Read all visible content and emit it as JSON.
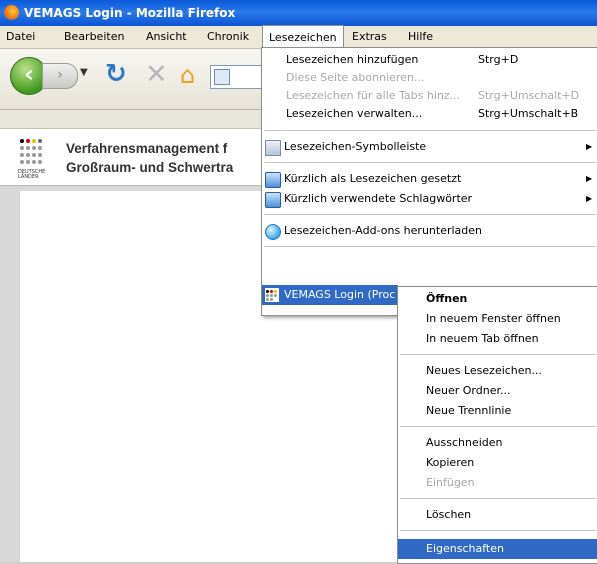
{
  "window": {
    "title": "VEMAGS Login - Mozilla Firefox"
  },
  "menubar": {
    "items": [
      {
        "label": "Datei"
      },
      {
        "label": "Bearbeiten"
      },
      {
        "label": "Ansicht"
      },
      {
        "label": "Chronik"
      },
      {
        "label": "Lesezeichen"
      },
      {
        "label": "Extras"
      },
      {
        "label": "Hilfe"
      }
    ]
  },
  "toolbar": {
    "back_icon": "back-arrow-icon",
    "forward_icon": "forward-arrow-icon",
    "reload_icon": "reload-icon",
    "stop_icon": "stop-icon",
    "home_icon": "home-icon"
  },
  "page": {
    "logo_caption": "DEUTSCHE LÄNDER",
    "title_line1": "Verfahrensmanagement f",
    "title_line2": "Großraum- und Schwertra"
  },
  "bookmarks_menu": {
    "items": [
      {
        "label": "Lesezeichen hinzufügen",
        "shortcut": "Strg+D",
        "disabled": false
      },
      {
        "label": "Diese Seite abonnieren...",
        "shortcut": "",
        "disabled": true
      },
      {
        "label": "Lesezeichen für alle Tabs hinz...",
        "shortcut": "Strg+Umschalt+D",
        "disabled": true
      },
      {
        "label": "Lesezeichen verwalten...",
        "shortcut": "Strg+Umschalt+B",
        "disabled": false
      },
      {
        "label": "Lesezeichen-Symbolleiste",
        "icon": "bookmarks-toolbar-icon",
        "submenu": true
      },
      {
        "label": "Kürzlich als Lesezeichen gesetzt",
        "icon": "smart-folder-icon",
        "submenu": true
      },
      {
        "label": "Kürzlich verwendete Schlagwörter",
        "icon": "smart-folder-icon",
        "submenu": true
      },
      {
        "label": "Lesezeichen-Add-ons herunterladen",
        "icon": "addons-globe-icon"
      },
      {
        "label": "VEMAGS Login (Proc",
        "icon": "vemags-favicon",
        "highlighted": true
      }
    ]
  },
  "context_menu": {
    "items": [
      {
        "label": "Öffnen",
        "bold": true
      },
      {
        "label": "In neuem Fenster öffnen"
      },
      {
        "label": "In neuem Tab öffnen"
      },
      {
        "label": "Neues Lesezeichen..."
      },
      {
        "label": "Neuer Ordner..."
      },
      {
        "label": "Neue Trennlinie"
      },
      {
        "label": "Ausschneiden"
      },
      {
        "label": "Kopieren"
      },
      {
        "label": "Einfügen",
        "disabled": true
      },
      {
        "label": "Löschen"
      },
      {
        "label": "Eigenschaften",
        "highlighted": true
      }
    ]
  },
  "colors": {
    "titlebar": "#0a5ad8",
    "highlight": "#316ac5",
    "menubar": "#ece9d8",
    "disabled_text": "#a8a8a8"
  }
}
